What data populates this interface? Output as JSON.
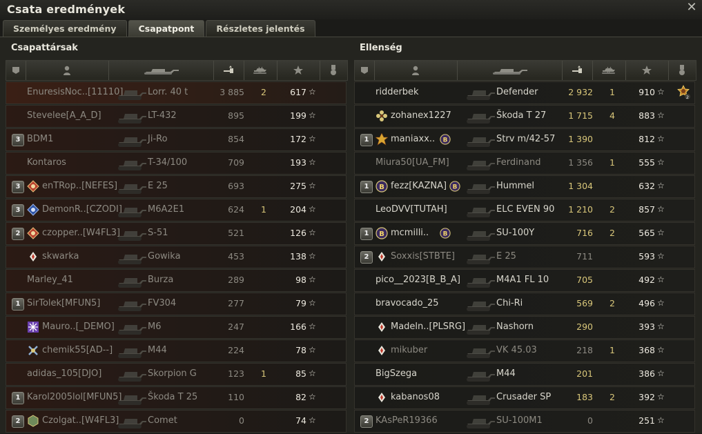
{
  "window": {
    "title": "Csata eredmények"
  },
  "tabs": [
    {
      "label": "Személyes eredmény",
      "active": false
    },
    {
      "label": "Csapatpont",
      "active": true
    },
    {
      "label": "Részletes jelentés",
      "active": false
    }
  ],
  "left": {
    "title": "Csapattársak",
    "rows": [
      {
        "platoon": "",
        "badge": "",
        "name": "EnuresisNoc..[11110]",
        "vehicle": "Lorr. 40 t",
        "damage": "3 885",
        "kills": "2",
        "xp": "617",
        "dead": true,
        "hl": true
      },
      {
        "platoon": "",
        "badge": "",
        "name": "Stevelee[A_A_D]",
        "vehicle": "LT-432",
        "damage": "895",
        "kills": "",
        "xp": "199",
        "dead": true
      },
      {
        "platoon": "3",
        "badge": "",
        "name": "BDM1",
        "vehicle": "Ji-Ro",
        "damage": "854",
        "kills": "",
        "xp": "172",
        "dead": true
      },
      {
        "platoon": "",
        "badge": "",
        "name": "Kontaros",
        "vehicle": "T-34/100",
        "damage": "709",
        "kills": "",
        "xp": "193",
        "dead": true
      },
      {
        "platoon": "3",
        "badge": "red-diamond",
        "name": "enTRop..[NEFES]",
        "vehicle": "E 25",
        "damage": "693",
        "kills": "",
        "xp": "275",
        "dead": true
      },
      {
        "platoon": "3",
        "badge": "blue-diamond",
        "name": "DemonR..[CZODI]",
        "vehicle": "M6A2E1",
        "damage": "624",
        "kills": "1",
        "xp": "204",
        "dead": true
      },
      {
        "platoon": "2",
        "badge": "red-diamond",
        "name": "czopper..[W4FL3]",
        "vehicle": "S-51",
        "damage": "521",
        "kills": "",
        "xp": "126",
        "dead": true
      },
      {
        "platoon": "",
        "badge": "small-diamond",
        "name": "skwarka",
        "vehicle": "Gowika",
        "damage": "453",
        "kills": "",
        "xp": "138",
        "dead": true
      },
      {
        "platoon": "",
        "badge": "",
        "name": "Marley_41",
        "vehicle": "Burza",
        "damage": "289",
        "kills": "",
        "xp": "98",
        "dead": true
      },
      {
        "platoon": "1",
        "badge": "",
        "name": "SirTolek[MFUN5]",
        "vehicle": "FV304",
        "damage": "277",
        "kills": "",
        "xp": "79",
        "dead": true
      },
      {
        "platoon": "",
        "badge": "snowflake",
        "name": "Mauro..[_DEMO]",
        "vehicle": "M6",
        "damage": "247",
        "kills": "",
        "xp": "166",
        "dead": true
      },
      {
        "platoon": "",
        "badge": "cross",
        "name": "chemik55[AD--]",
        "vehicle": "M44",
        "damage": "224",
        "kills": "",
        "xp": "78",
        "dead": true
      },
      {
        "platoon": "",
        "badge": "",
        "name": "adidas_105[DJO]",
        "vehicle": "Skorpion G",
        "damage": "123",
        "kills": "1",
        "xp": "85",
        "dead": true
      },
      {
        "platoon": "1",
        "badge": "",
        "name": "Karol2005lol[MFUN5]",
        "vehicle": "Škoda T 25",
        "damage": "110",
        "kills": "",
        "xp": "82",
        "dead": true
      },
      {
        "platoon": "2",
        "badge": "cube",
        "name": "Czolgat..[W4FL3]",
        "vehicle": "Comet",
        "damage": "0",
        "kills": "",
        "xp": "74",
        "dead": true
      }
    ]
  },
  "right": {
    "title": "Ellenség",
    "rows": [
      {
        "platoon": "",
        "badge": "",
        "name": "ridderbek",
        "vehicle": "Defender",
        "damage": "2 932",
        "kills": "1",
        "xp": "910",
        "dead": false,
        "medal": "2"
      },
      {
        "platoon": "",
        "badge": "flower",
        "name": "zohanex1227",
        "vehicle": "Škoda T 27",
        "damage": "1 715",
        "kills": "4",
        "xp": "883",
        "dead": false
      },
      {
        "platoon": "1",
        "badge": "gold-cross",
        "name": "maniaxx..",
        "vehicle": "Strv m/42-57",
        "damage": "1 390",
        "kills": "",
        "xp": "812",
        "dead": false,
        "coin": "B"
      },
      {
        "platoon": "",
        "badge": "",
        "name": "Miura50[UA_FM]",
        "vehicle": "Ferdinand",
        "damage": "1 356",
        "kills": "1",
        "xp": "555",
        "dead": true
      },
      {
        "platoon": "1",
        "badge": "coin",
        "name": "fezz[KAZNA]",
        "vehicle": "Hummel",
        "damage": "1 304",
        "kills": "",
        "xp": "632",
        "dead": false,
        "coin": "B"
      },
      {
        "platoon": "",
        "badge": "",
        "name": "LeoDVV[TUTAH]",
        "vehicle": "ELC EVEN 90",
        "damage": "1 210",
        "kills": "2",
        "xp": "857",
        "dead": false
      },
      {
        "platoon": "1",
        "badge": "coin",
        "name": "mcmilli..",
        "vehicle": "SU-100Y",
        "damage": "716",
        "kills": "2",
        "xp": "565",
        "dead": false,
        "coin": "B"
      },
      {
        "platoon": "2",
        "badge": "small-diamond",
        "name": "Soxxis[STBTE]",
        "vehicle": "E 25",
        "damage": "711",
        "kills": "",
        "xp": "593",
        "dead": true
      },
      {
        "platoon": "",
        "badge": "",
        "name": "pico__2023[B_B_A]",
        "vehicle": "M4A1 FL 10",
        "damage": "705",
        "kills": "",
        "xp": "492",
        "dead": false
      },
      {
        "platoon": "",
        "badge": "",
        "name": "bravocado_25",
        "vehicle": "Chi-Ri",
        "damage": "569",
        "kills": "2",
        "xp": "496",
        "dead": false
      },
      {
        "platoon": "",
        "badge": "small-diamond",
        "name": "Madeln..[PLSRG]",
        "vehicle": "Nashorn",
        "damage": "290",
        "kills": "",
        "xp": "393",
        "dead": false
      },
      {
        "platoon": "",
        "badge": "small-diamond",
        "name": "mikuber",
        "vehicle": "VK 45.03",
        "damage": "218",
        "kills": "1",
        "xp": "368",
        "dead": true
      },
      {
        "platoon": "",
        "badge": "",
        "name": "BigSzega",
        "vehicle": "M44",
        "damage": "201",
        "kills": "",
        "xp": "386",
        "dead": false
      },
      {
        "platoon": "",
        "badge": "small-diamond",
        "name": "kabanos08",
        "vehicle": "Crusader SP",
        "damage": "183",
        "kills": "2",
        "xp": "392",
        "dead": false
      },
      {
        "platoon": "2",
        "badge": "",
        "name": "KAsPeR19366",
        "vehicle": "SU-100M1",
        "damage": "0",
        "kills": "",
        "xp": "251",
        "dead": true
      }
    ]
  },
  "star_glyph": "☆",
  "close_glyph": "✕",
  "colors": {
    "accent": "#d9c77a",
    "text": "#cfcfc6",
    "dim": "#8d8a82"
  }
}
